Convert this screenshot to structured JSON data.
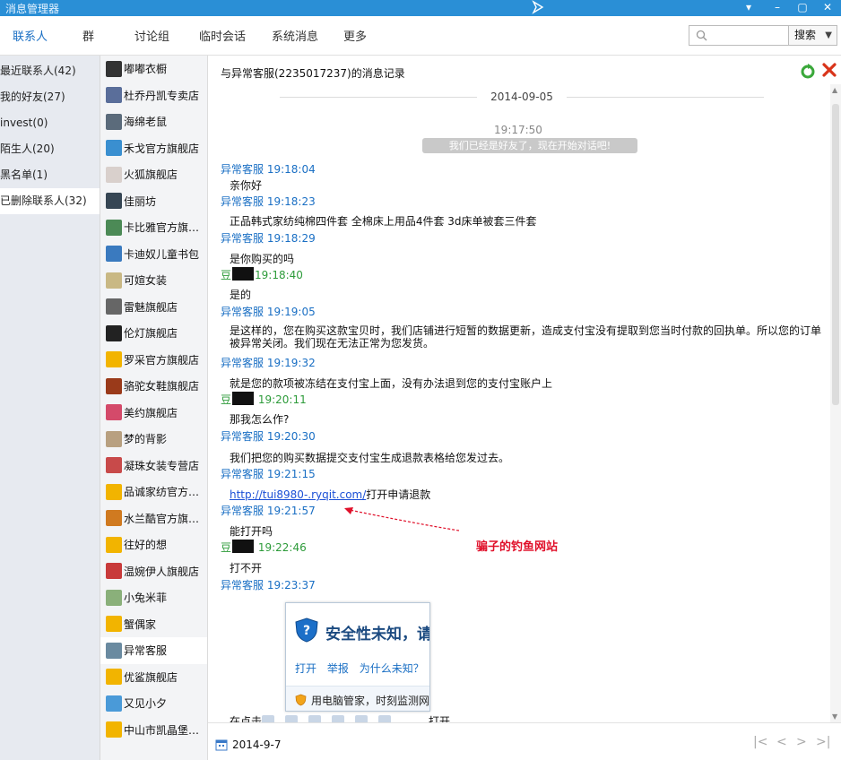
{
  "window": {
    "title": "消息管理器",
    "controls": [
      "▾",
      "–",
      "▢",
      "✕"
    ]
  },
  "tabs": [
    {
      "label": "联系人",
      "active": true
    },
    {
      "label": "群",
      "active": false
    },
    {
      "label": "讨论组",
      "active": false
    },
    {
      "label": "临时会话",
      "active": false
    },
    {
      "label": "系统消息",
      "active": false
    },
    {
      "label": "更多",
      "active": false
    }
  ],
  "search": {
    "value": "",
    "button_label": "搜索",
    "arrow": "▼"
  },
  "leftnav": {
    "items": [
      {
        "label": "最近联系人(42)"
      },
      {
        "label": "我的好友(27)"
      },
      {
        "label": "invest(0)"
      },
      {
        "label": "陌生人(20)"
      },
      {
        "label": "黑名单(1)"
      },
      {
        "label": "已删除联系人(32)"
      }
    ]
  },
  "contacts": [
    {
      "name": "嘟嘟衣橱",
      "color": "#333333"
    },
    {
      "name": "杜乔丹凯专卖店",
      "color": "#5a6e9a"
    },
    {
      "name": "海绵老鼠",
      "color": "#5b6b7b"
    },
    {
      "name": "禾戈官方旗舰店",
      "color": "#3a8fd0"
    },
    {
      "name": "火狐旗舰店",
      "color": "#d9d0cc"
    },
    {
      "name": "佳丽坊",
      "color": "#364654"
    },
    {
      "name": "卡比雅官方旗…",
      "color": "#4c8a56"
    },
    {
      "name": "卡迪奴儿童书包",
      "color": "#3a7abf"
    },
    {
      "name": "可媗女装",
      "color": "#c9b884"
    },
    {
      "name": "雷魅旗舰店",
      "color": "#666666"
    },
    {
      "name": "伦灯旗舰店",
      "color": "#222222"
    },
    {
      "name": "罗采官方旗舰店",
      "color": "#f2b400"
    },
    {
      "name": "骆驼女鞋旗舰店",
      "color": "#9a3a1a"
    },
    {
      "name": "美约旗舰店",
      "color": "#d44a6a"
    },
    {
      "name": "梦的背影",
      "color": "#b8a080"
    },
    {
      "name": "凝珠女装专营店",
      "color": "#c84a4a"
    },
    {
      "name": "品诚家纺官方…",
      "color": "#f2b400"
    },
    {
      "name": "水兰酷官方旗…",
      "color": "#d07a20"
    },
    {
      "name": "往好的想",
      "color": "#f2b400"
    },
    {
      "name": "温婉伊人旗舰店",
      "color": "#c83a3a"
    },
    {
      "name": "小兔米菲",
      "color": "#8ab07a"
    },
    {
      "name": "蟹偶家",
      "color": "#f2b400"
    },
    {
      "name": "异常客服",
      "color": "#6a8aa0",
      "selected": true
    },
    {
      "name": "优鲨旗舰店",
      "color": "#f2b400"
    },
    {
      "name": "又见小夕",
      "color": "#4a9ad8"
    },
    {
      "name": "中山市凯晶堡…",
      "color": "#f2b400"
    }
  ],
  "main": {
    "record_title": "与异常客服(2235017237)的消息记录",
    "date": "2014-09-05",
    "first_time": "19:17:50",
    "notice": "我们已经是好友了，现在开始对话吧!",
    "messages": [
      {
        "sender": "异常客服",
        "time": "19:18:04",
        "text": "亲你好"
      },
      {
        "sender": "异常客服",
        "time": "19:18:23",
        "text": "正品韩式家纺纯棉四件套 全棉床上用品4件套 3d床单被套三件套"
      },
      {
        "sender": "异常客服",
        "time": "19:18:29",
        "text": "是你购买的吗"
      },
      {
        "sender": "豆",
        "time": "19:18:40",
        "text": "是的"
      },
      {
        "sender": "异常客服",
        "time": "19:19:05",
        "text": "是这样的，您在购买这款宝贝时，我们店铺进行短暂的数据更新，造成支付宝没有提取到您当时付款的回执单。所以您的订单被异常关闭。我们现在无法正常为您发货。"
      },
      {
        "sender": "异常客服",
        "time": "19:19:32",
        "text": "就是您的款项被冻结在支付宝上面，没有办法退到您的支付宝账户上"
      },
      {
        "sender": "豆",
        "time": "19:20:11",
        "text": "那我怎么作?"
      },
      {
        "sender": "异常客服",
        "time": "19:20:30",
        "text": "我们把您的购买数据提交支付宝生成退款表格给您发过去。"
      },
      {
        "sender": "异常客服",
        "time": "19:21:15",
        "link": "http://tui8980-.ryqit.com/",
        "text": "打开申请退款"
      },
      {
        "sender": "异常客服",
        "time": "19:21:57",
        "text": "能打开吗"
      },
      {
        "sender": "豆",
        "time": "19:22:46",
        "text": "打不开"
      },
      {
        "sender": "异常客服",
        "time": "19:23:37",
        "text": ""
      }
    ],
    "annotation": "骗子的钓鱼网站",
    "popup": {
      "title": "安全性未知，请",
      "links": [
        "打开",
        "举报",
        "为什么未知？"
      ],
      "footer": "用电脑管家，时刻监测网"
    },
    "partial_text": "在点击",
    "partial_text2": "打开",
    "footer_date": "2014-9-7",
    "pager": [
      "|<",
      "<",
      ">",
      ">|"
    ]
  }
}
